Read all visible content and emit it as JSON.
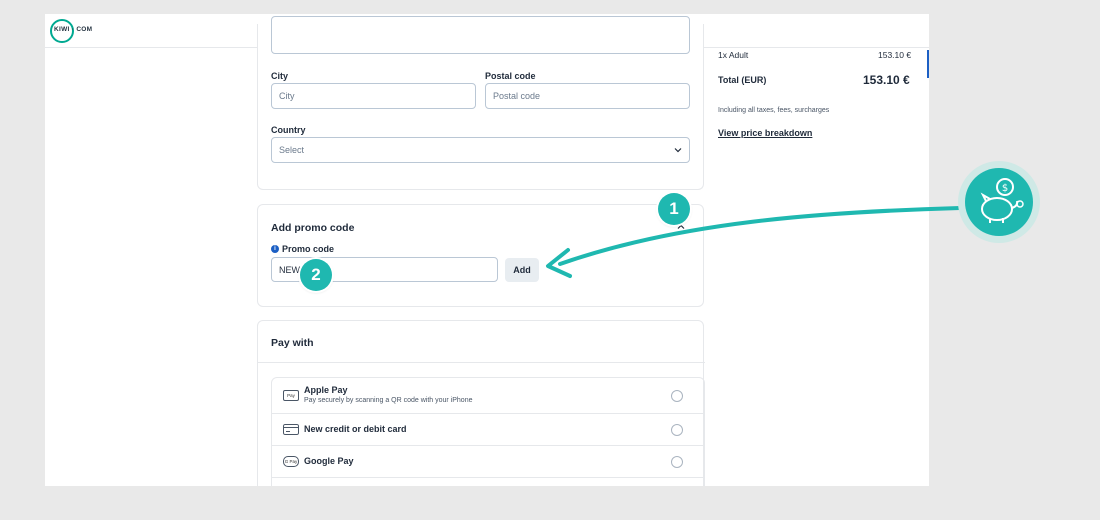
{
  "header": {
    "logo_text": "KIWI · COM"
  },
  "address": {
    "city_label": "City",
    "city_placeholder": "City",
    "postal_label": "Postal code",
    "postal_placeholder": "Postal code",
    "country_label": "Country",
    "country_value": "Select"
  },
  "promo": {
    "title": "Add promo code",
    "field_label": "Promo code",
    "value": "NEW",
    "add_label": "Add"
  },
  "payment": {
    "title": "Pay with",
    "methods": [
      {
        "name": "Apple Pay",
        "description": "Pay securely by scanning a QR code with your iPhone",
        "icon": "apple-pay-icon",
        "icon_text": "Pay"
      },
      {
        "name": "New credit or debit card",
        "icon": "credit-card-icon"
      },
      {
        "name": "Google Pay",
        "icon": "google-pay-icon",
        "icon_text": "G Pay"
      }
    ]
  },
  "summary": {
    "passenger_label": "1x Adult",
    "passenger_price": "153.10 €",
    "total_label": "Total (EUR)",
    "total_price": "153.10 €",
    "taxes_note": "Including all taxes, fees, surcharges",
    "breakdown_link": "View price breakdown"
  },
  "annotations": {
    "step1": "1",
    "step2": "2",
    "accent_color": "#1fb8b0",
    "icon": "piggy-bank-coin-icon"
  }
}
